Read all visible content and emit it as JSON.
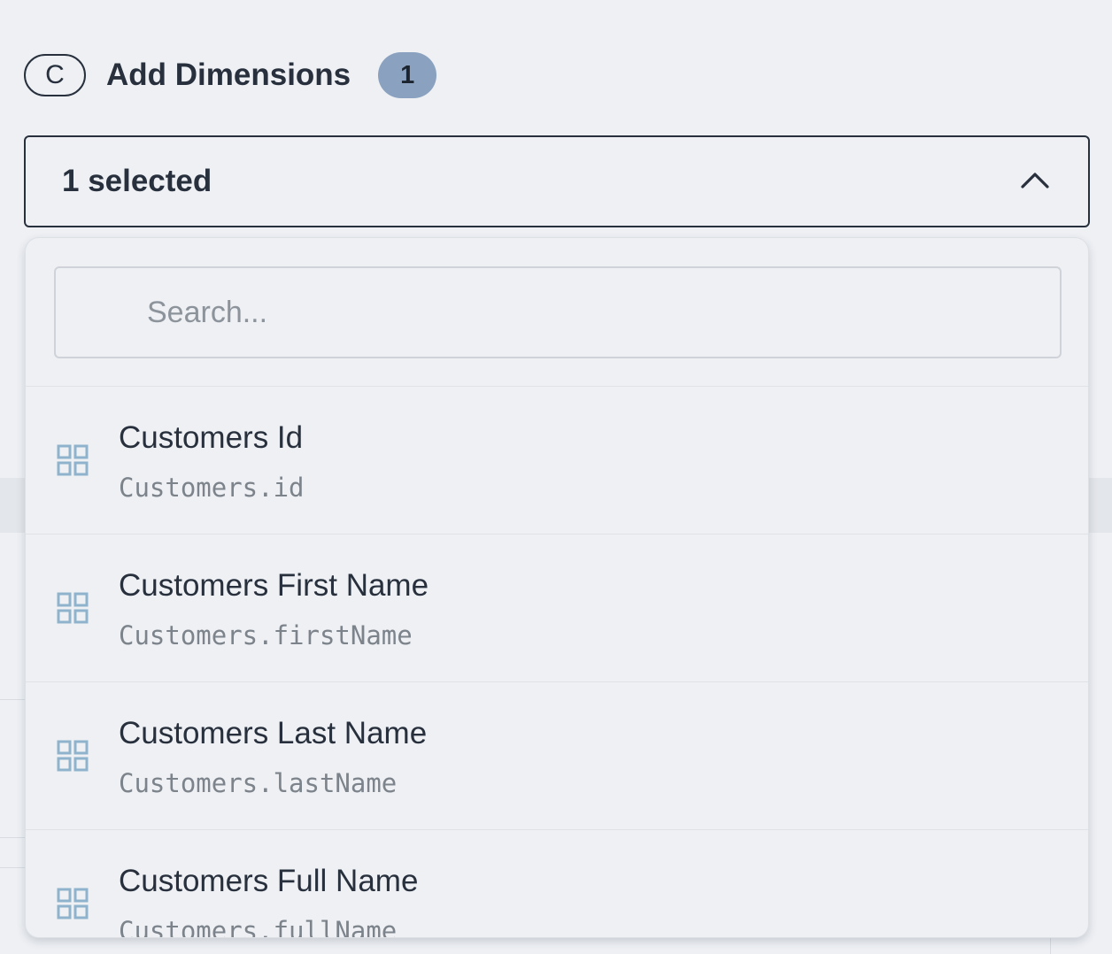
{
  "header": {
    "step_letter": "C",
    "title": "Add Dimensions",
    "count": "1"
  },
  "select": {
    "value": "1 selected",
    "icon": "chevron-up-icon"
  },
  "search": {
    "placeholder": "Search..."
  },
  "options": [
    {
      "title": "Customers Id",
      "key": "Customers.id",
      "icon": "dimension-grid-icon"
    },
    {
      "title": "Customers First Name",
      "key": "Customers.firstName",
      "icon": "dimension-grid-icon"
    },
    {
      "title": "Customers Last Name",
      "key": "Customers.lastName",
      "icon": "dimension-grid-icon"
    },
    {
      "title": "Customers Full Name",
      "key": "Customers.fullName",
      "icon": "dimension-grid-icon"
    }
  ],
  "colors": {
    "text": "#27303c",
    "badge_bg": "#8aa2bf",
    "icon": "#8fb3cc",
    "muted": "#7c838b",
    "background": "#eef0f4"
  }
}
